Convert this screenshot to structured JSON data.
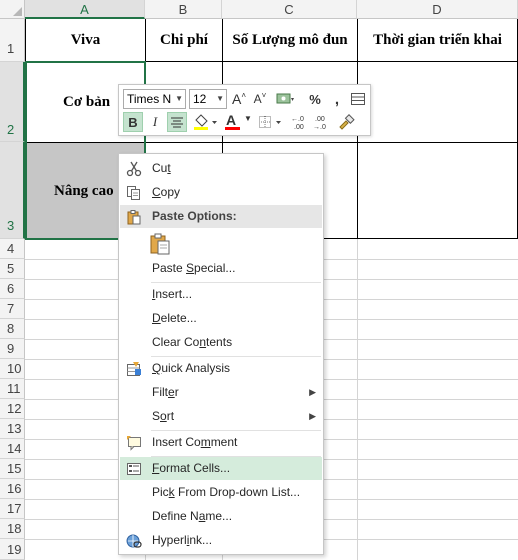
{
  "columns": [
    "A",
    "B",
    "C",
    "D"
  ],
  "rows": [
    "1",
    "2",
    "3",
    "4",
    "5",
    "6",
    "7",
    "8",
    "9",
    "10",
    "11",
    "12",
    "13",
    "14",
    "15",
    "16",
    "17",
    "18",
    "19"
  ],
  "cells": {
    "A1": "Viva",
    "B1": "Chi phí",
    "C1": "Số Lượng mô đun",
    "D1": "Thời gian triển khai",
    "A2": "Cơ bản",
    "A3": "Nâng cao"
  },
  "mini_toolbar": {
    "font_name": "Times N",
    "font_size": "12",
    "grow_font": "A",
    "shrink_font": "A",
    "percent": "%",
    "comma": ",",
    "bold": "B",
    "italic": "I",
    "font_color_letter": "A",
    "increase_decimal": "←.0 .00",
    "decrease_decimal": ".00 →.0",
    "fill_color": "#ffff00",
    "font_color": "#ff0000"
  },
  "context_menu": {
    "cut": {
      "pre": "Cu",
      "key": "t",
      "post": ""
    },
    "copy": {
      "pre": "",
      "key": "C",
      "post": "opy"
    },
    "paste_options": "Paste Options:",
    "paste_special": {
      "pre": "Paste ",
      "key": "S",
      "post": "pecial..."
    },
    "insert": {
      "pre": "",
      "key": "I",
      "post": "nsert..."
    },
    "delete": {
      "pre": "",
      "key": "D",
      "post": "elete..."
    },
    "clear_contents": {
      "pre": "Clear Co",
      "key": "n",
      "post": "tents"
    },
    "quick_analysis": {
      "pre": "",
      "key": "Q",
      "post": "uick Analysis"
    },
    "filter": {
      "pre": "Filt",
      "key": "e",
      "post": "r"
    },
    "sort": {
      "pre": "S",
      "key": "o",
      "post": "rt"
    },
    "insert_comment": {
      "pre": "Insert Co",
      "key": "m",
      "post": "ment"
    },
    "format_cells": {
      "pre": "",
      "key": "F",
      "post": "ormat Cells..."
    },
    "pick_from_list": {
      "pre": "Pic",
      "key": "k",
      "post": " From Drop-down List..."
    },
    "define_name": {
      "pre": "Define N",
      "key": "a",
      "post": "me..."
    },
    "hyperlink": {
      "pre": "Hyperl",
      "key": "i",
      "post": "nk..."
    }
  },
  "colors": {
    "selection": "#217346",
    "hover": "#d5ecdc",
    "selected_cell_fill": "#c6c6c6"
  }
}
